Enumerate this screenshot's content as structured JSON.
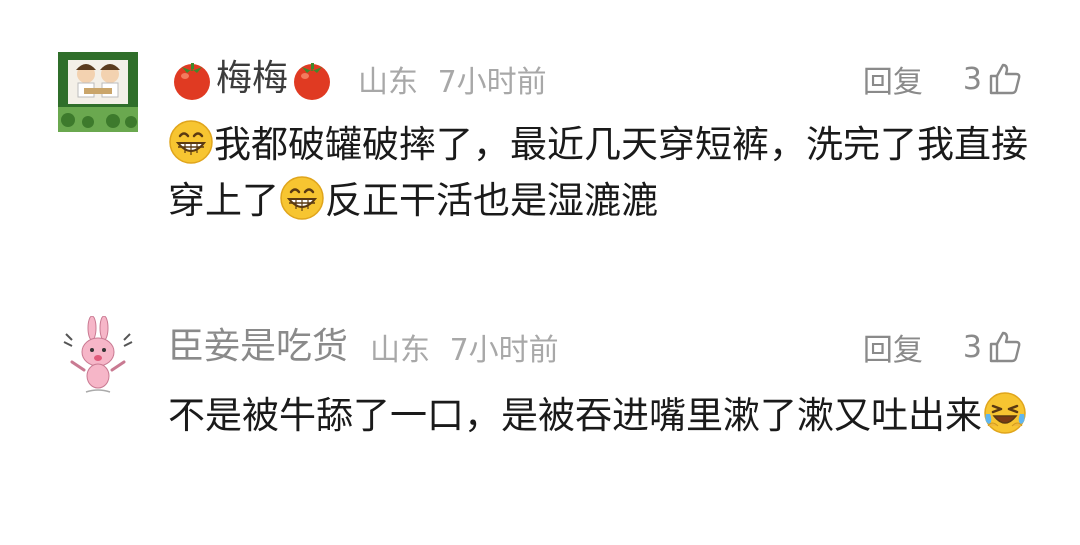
{
  "comments": [
    {
      "username": "梅梅",
      "location": "山东",
      "time": "7小时前",
      "reply_label": "回复",
      "likes": "3",
      "text_parts": [
        "我都破罐破摔了，最近几天穿短裤，洗完了我直接穿上了",
        "反正干活也是湿漉漉"
      ]
    },
    {
      "username": "臣妾是吃货",
      "location": "山东",
      "time": "7小时前",
      "reply_label": "回复",
      "likes": "3",
      "text_parts": [
        "不是被牛舔了一口，是被吞进嘴里漱了漱又吐出来"
      ]
    }
  ],
  "icons": {
    "username_decoration": "tomato-icon",
    "like": "thumbs-up-icon",
    "emoji_grin": "grinning-emoji-icon",
    "emoji_laugh": "laughing-crying-emoji-icon"
  },
  "colors": {
    "username": "#3c3c3c",
    "username_secondary": "#8a8a8a",
    "meta": "#a8a8a8",
    "body_text": "#1a1a1a",
    "tomato": "#e03a22",
    "emoji_face": "#f7c531"
  }
}
